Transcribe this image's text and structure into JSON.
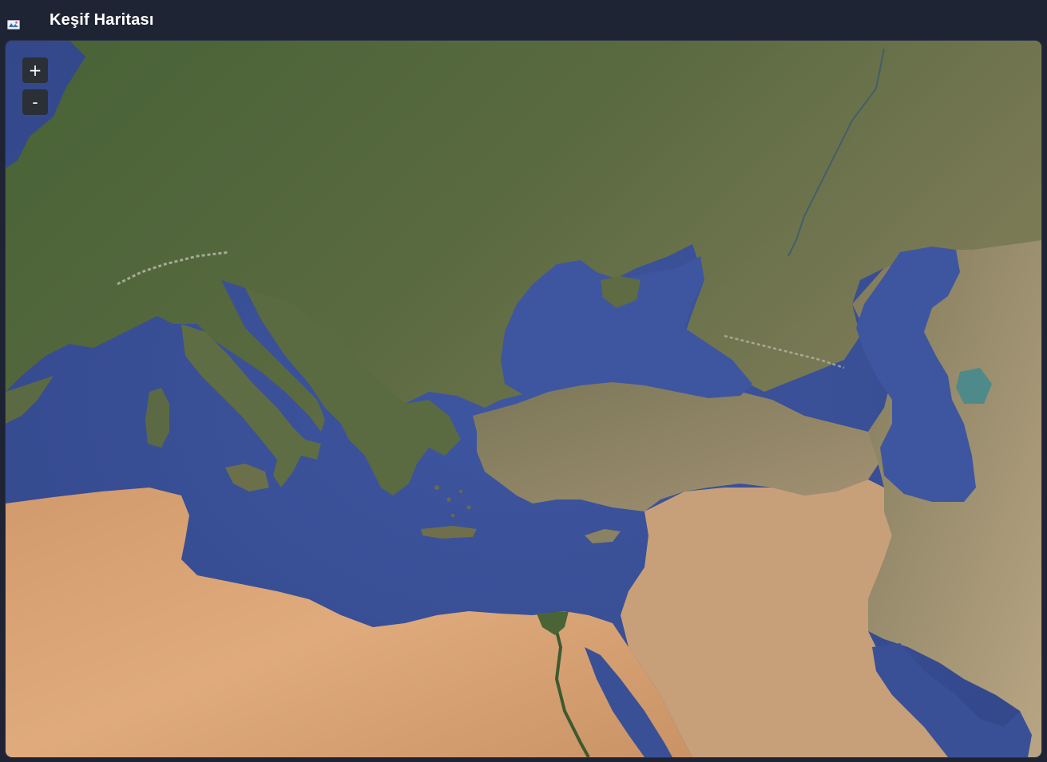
{
  "header": {
    "icon": "map-icon",
    "title": "Keşif Haritası"
  },
  "map": {
    "view": "satellite",
    "region": "Europe, Mediterranean, Middle East",
    "zoom_controls": {
      "zoom_in_label": "+",
      "zoom_out_label": "-"
    },
    "colors": {
      "sea": "#3a5096",
      "land_north": "#4a5e38",
      "land_mid": "#5e6a44",
      "desert": "#d39a6a",
      "steppe": "#a59876",
      "background": "#1e2433"
    }
  }
}
